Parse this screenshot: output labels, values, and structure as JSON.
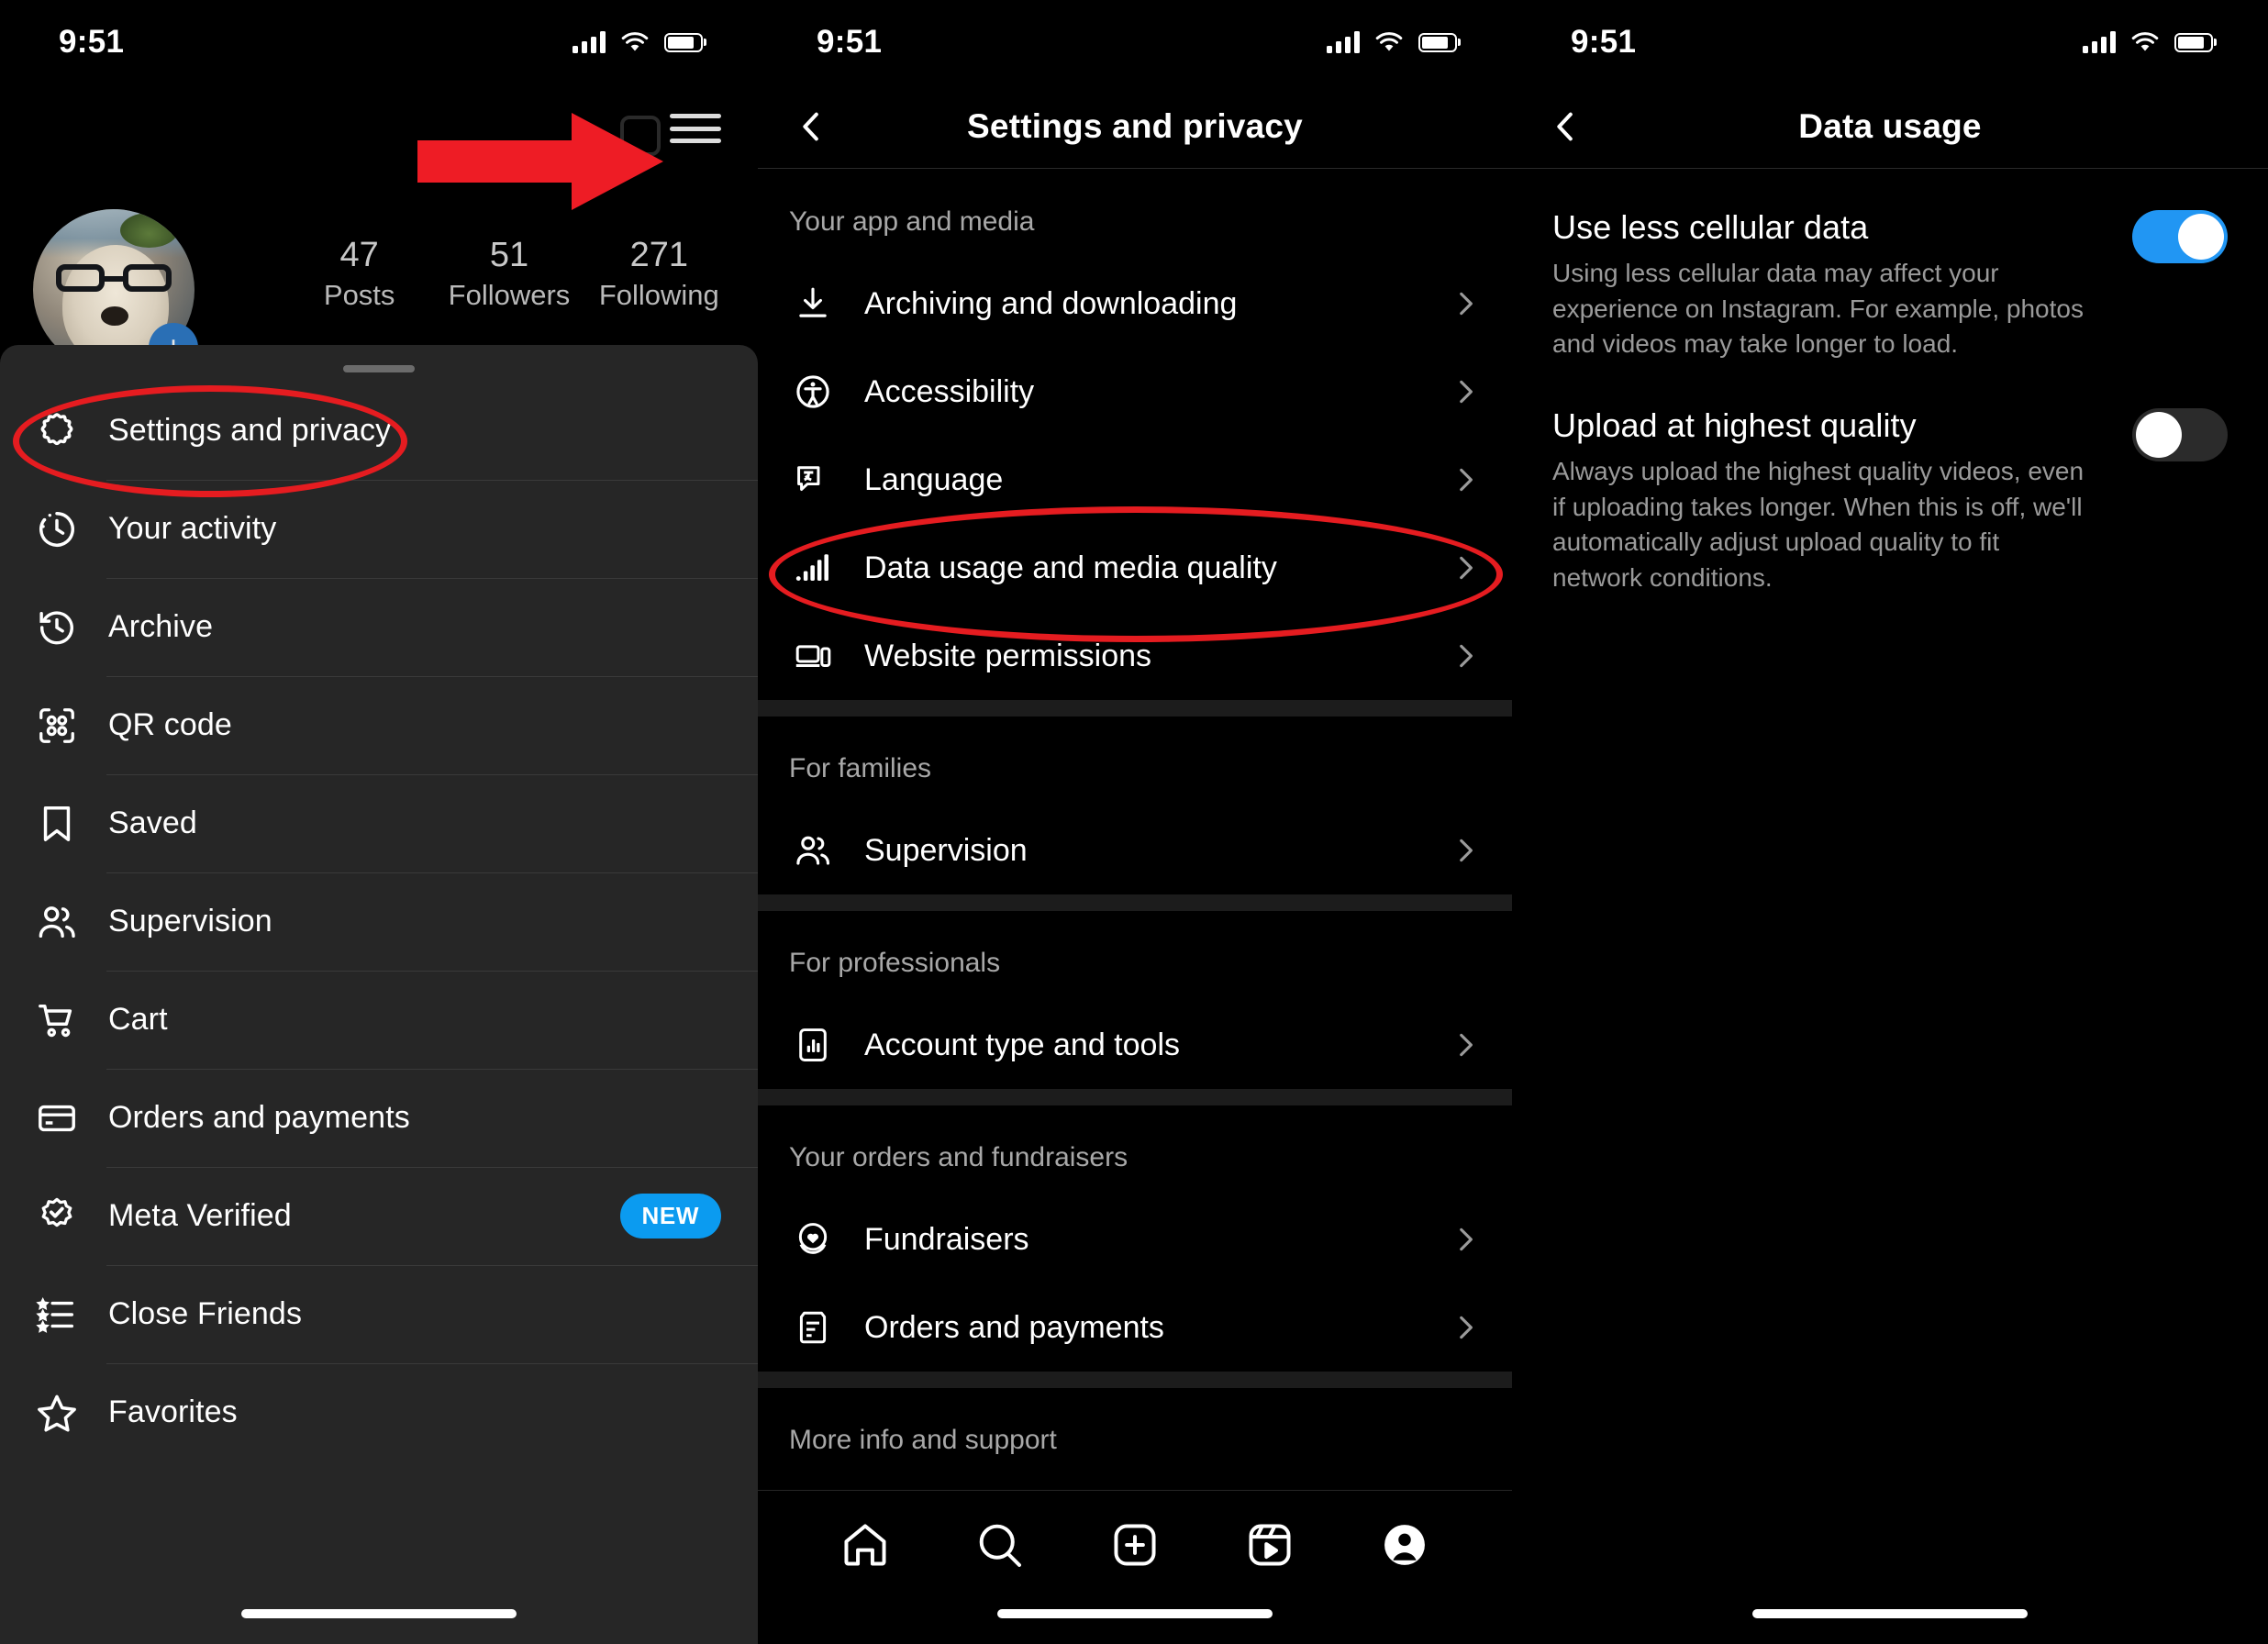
{
  "status_bar": {
    "time": "9:51",
    "signal_icon": "cellular-signal-icon",
    "wifi_icon": "wifi-icon",
    "battery_icon": "battery-icon"
  },
  "accent": {
    "blue": "#0b9bf0",
    "toggle_on": "#2196f3",
    "annotation_red": "#e51c20"
  },
  "panel_profile": {
    "hamburger_label": "hamburger-menu",
    "stats": [
      {
        "num": "47",
        "lbl": "Posts"
      },
      {
        "num": "51",
        "lbl": "Followers"
      },
      {
        "num": "271",
        "lbl": "Following"
      }
    ],
    "menu_items": [
      {
        "icon": "settings-gear-icon",
        "label": "Settings and privacy",
        "badge": ""
      },
      {
        "icon": "activity-clock-icon",
        "label": "Your activity",
        "badge": ""
      },
      {
        "icon": "archive-clock-icon",
        "label": "Archive",
        "badge": ""
      },
      {
        "icon": "qr-code-icon",
        "label": "QR code",
        "badge": ""
      },
      {
        "icon": "bookmark-icon",
        "label": "Saved",
        "badge": ""
      },
      {
        "icon": "supervision-people-icon",
        "label": "Supervision",
        "badge": ""
      },
      {
        "icon": "shopping-cart-icon",
        "label": "Cart",
        "badge": ""
      },
      {
        "icon": "credit-card-icon",
        "label": "Orders and payments",
        "badge": ""
      },
      {
        "icon": "verified-badge-icon",
        "label": "Meta Verified",
        "badge": "NEW"
      },
      {
        "icon": "close-friends-list-icon",
        "label": "Close Friends",
        "badge": ""
      },
      {
        "icon": "star-icon",
        "label": "Favorites",
        "badge": ""
      }
    ]
  },
  "panel_settings": {
    "title": "Settings and privacy",
    "back_icon": "chevron-left-icon",
    "sections": [
      {
        "heading": "Your app and media",
        "rows": [
          {
            "icon": "download-icon",
            "label": "Archiving and downloading"
          },
          {
            "icon": "accessibility-icon",
            "label": "Accessibility"
          },
          {
            "icon": "language-icon",
            "label": "Language"
          },
          {
            "icon": "bar-chart-signal-icon",
            "label": "Data usage and media quality"
          },
          {
            "icon": "website-permissions-icon",
            "label": "Website permissions"
          }
        ]
      },
      {
        "heading": "For families",
        "rows": [
          {
            "icon": "supervision-people-icon",
            "label": "Supervision"
          }
        ]
      },
      {
        "heading": "For professionals",
        "rows": [
          {
            "icon": "account-tools-icon",
            "label": "Account type and tools"
          }
        ]
      },
      {
        "heading": "Your orders and fundraisers",
        "rows": [
          {
            "icon": "fundraiser-heart-icon",
            "label": "Fundraisers"
          },
          {
            "icon": "orders-receipt-icon",
            "label": "Orders and payments"
          }
        ]
      },
      {
        "heading": "More info and support",
        "rows": []
      }
    ],
    "tabbar": [
      {
        "icon": "home-icon"
      },
      {
        "icon": "search-icon"
      },
      {
        "icon": "create-plus-icon"
      },
      {
        "icon": "reels-icon"
      },
      {
        "icon": "profile-avatar-icon"
      }
    ]
  },
  "panel_data_usage": {
    "title": "Data usage",
    "back_icon": "chevron-left-icon",
    "rows": [
      {
        "title": "Use less cellular data",
        "desc": "Using less cellular data may affect your experience on Instagram. For example, photos and videos may take longer to load.",
        "toggle": "on"
      },
      {
        "title": "Upload at highest quality",
        "desc": "Always upload the highest quality videos, even if uploading takes longer. When this is off, we'll automatically adjust upload quality to fit network conditions.",
        "toggle": "off"
      }
    ]
  }
}
